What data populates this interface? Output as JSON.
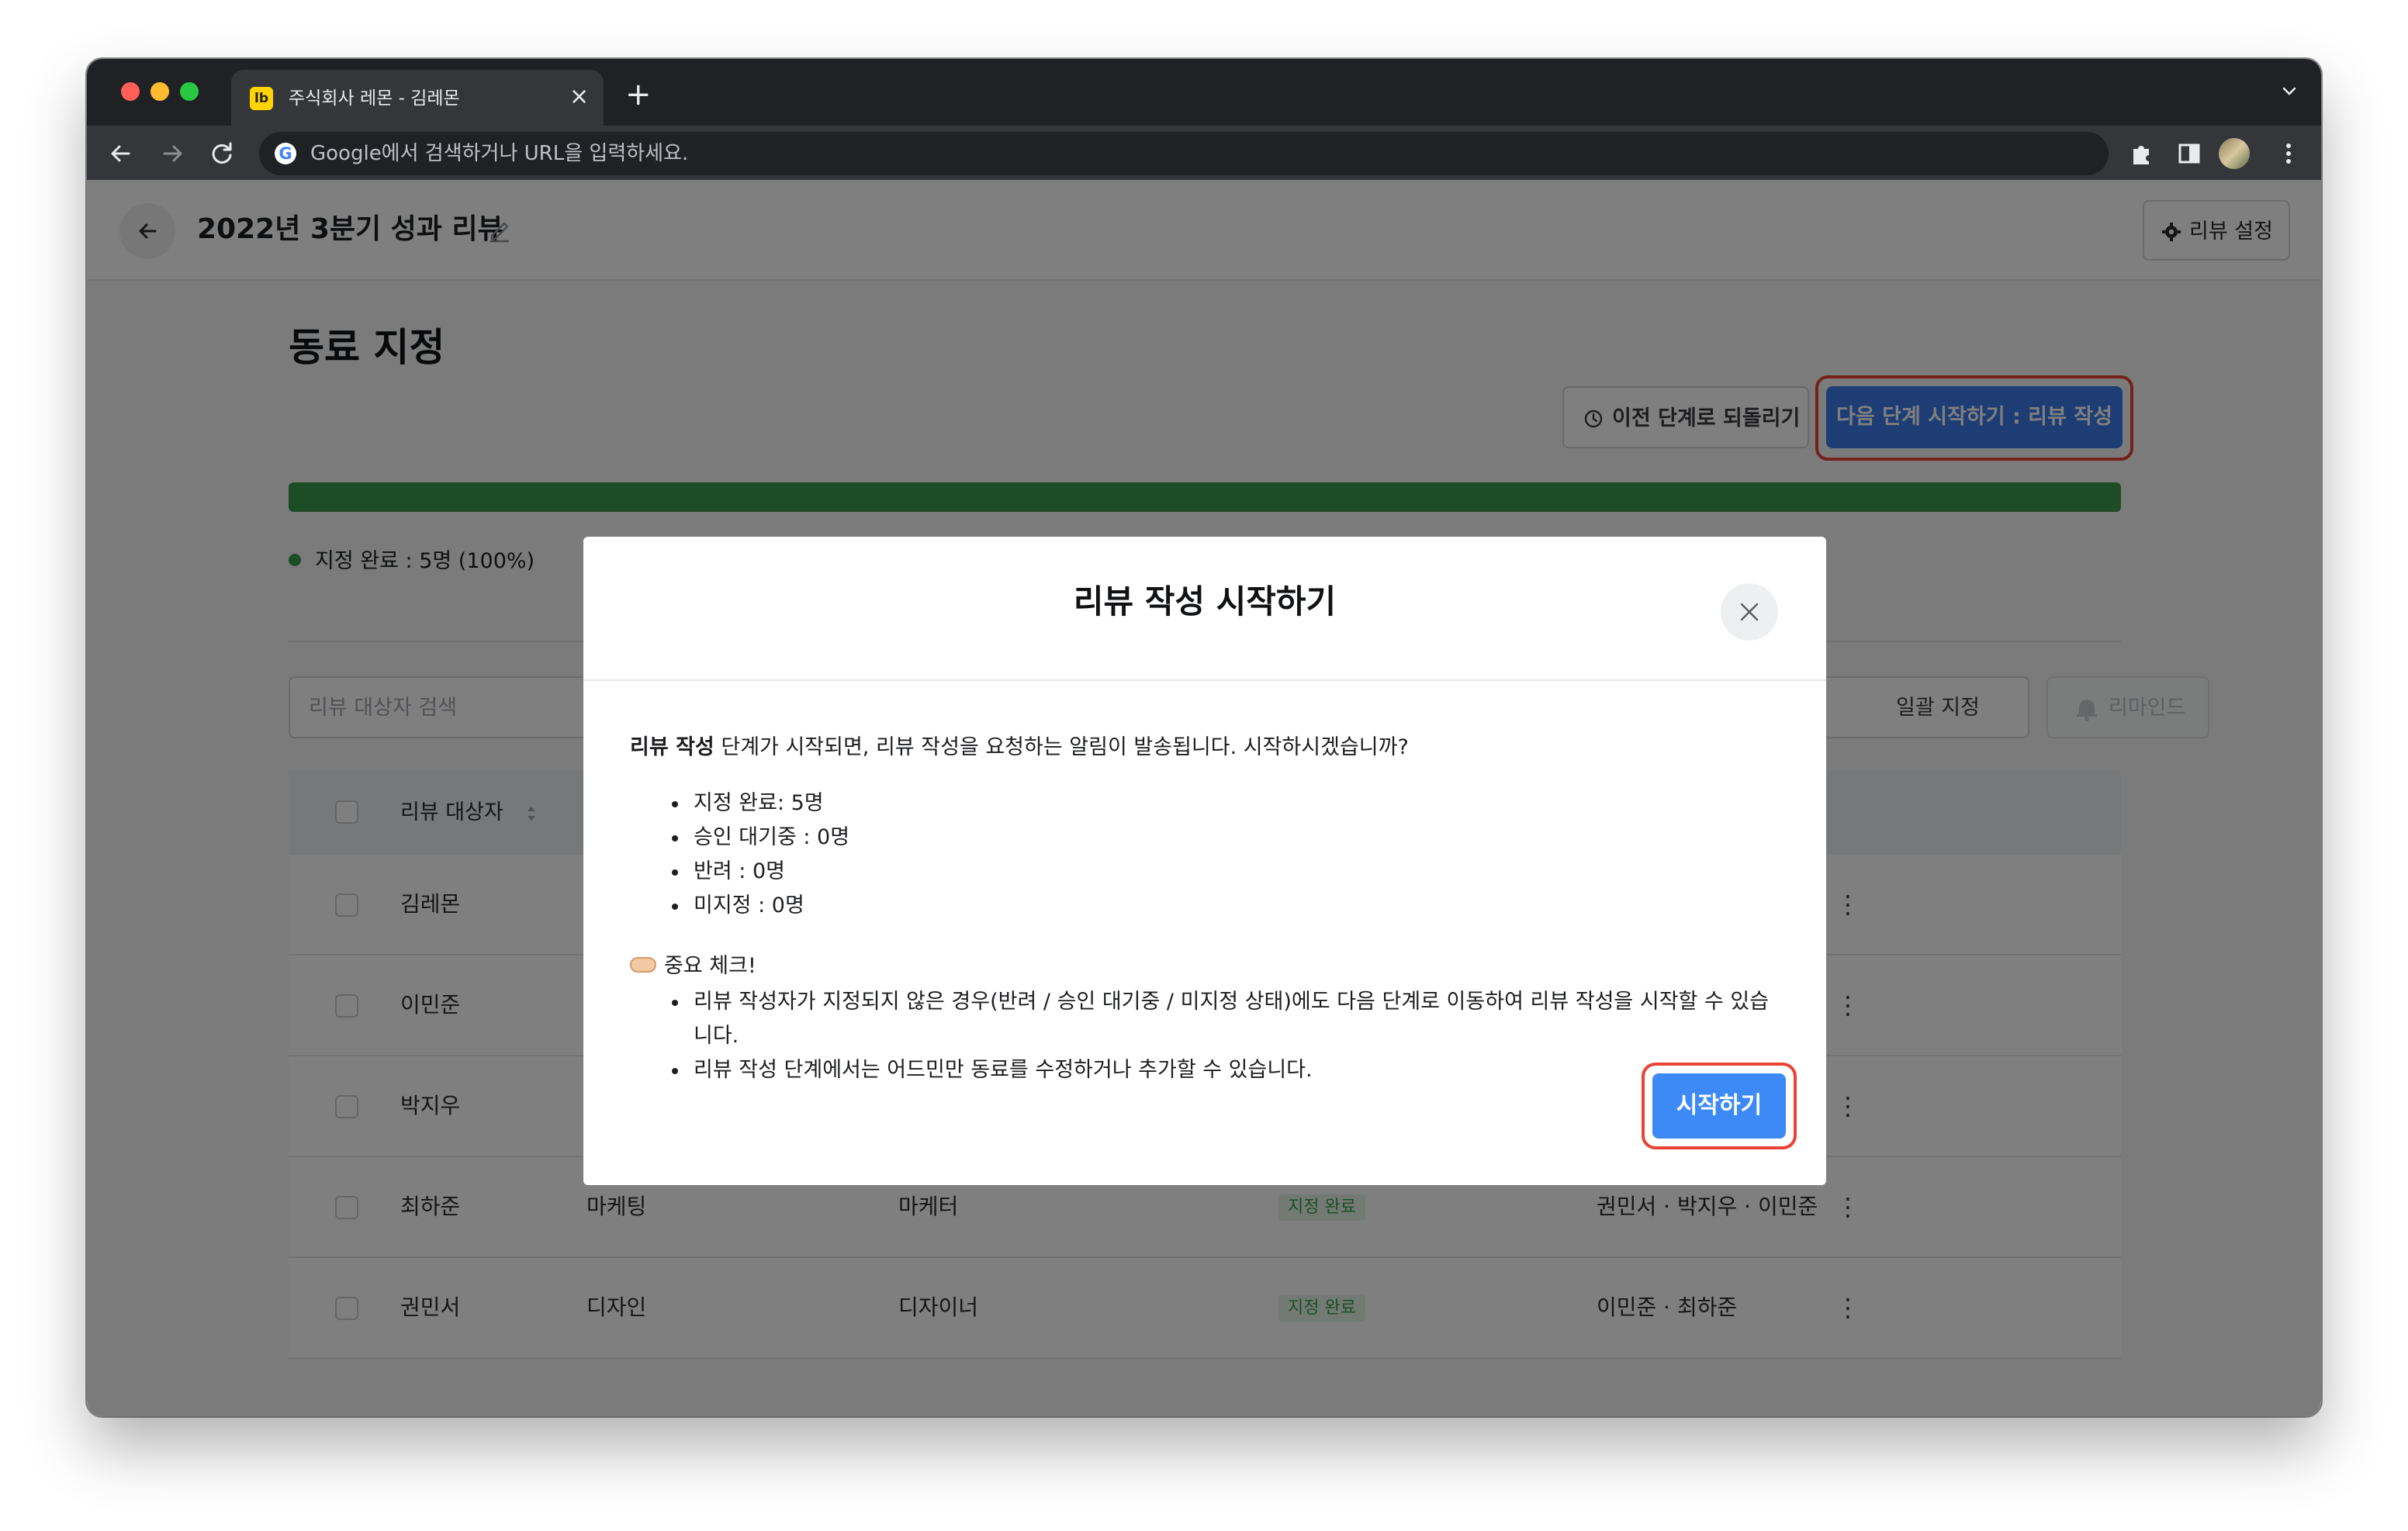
{
  "browser": {
    "tab_title": "주식회사 레몬 - 김레몬",
    "tab_favicon_text": "lb",
    "omnibox_placeholder": "Google에서 검색하거나 URL을 입력하세요."
  },
  "header": {
    "title": "2022년 3분기 성과 리뷰",
    "settings_label": "리뷰 설정"
  },
  "main": {
    "section_title": "동료 지정",
    "revert_label": "이전 단계로 되돌리기",
    "next_label": "다음 단계 시작하기 : 리뷰 작성",
    "progress_fraction": 1.0,
    "legend_label": "지정 완료 : 5명 (100%)",
    "search_placeholder": "리뷰 대상자 검색",
    "bulk_label": "일괄 지정",
    "remind_label": "리마인드",
    "table": {
      "header_target": "리뷰 대상자",
      "rows": [
        {
          "name": "김레몬"
        },
        {
          "name": "이민준"
        },
        {
          "name": "박지우"
        },
        {
          "name": "최하준",
          "dept": "마케팅",
          "role": "마케터",
          "status": "지정 완료",
          "peers": "권민서 · 박지우 · 이민준"
        },
        {
          "name": "권민서",
          "dept": "디자인",
          "role": "디자이너",
          "status": "지정 완료",
          "peers": "이민준 · 최하준"
        }
      ]
    }
  },
  "modal": {
    "title": "리뷰 작성 시작하기",
    "intro_bold": "리뷰 작성",
    "intro_rest": " 단계가 시작되면, 리뷰 작성을 요청하는 알림이 발송됩니다. 시작하시겠습니까?",
    "stats": [
      "지정 완료: 5명",
      "승인 대기중 : 0명",
      "반려 : 0명",
      "미지정 : 0명"
    ],
    "check_title": "중요 체크!",
    "notes": [
      "리뷰 작성자가 지정되지 않은 경우(반려 / 승인 대기중 / 미지정 상태)에도 다음 단계로 이동하여 리뷰 작성을 시작할 수 있습니다.",
      "리뷰 작성 단계에서는 어드민만 동료를 수정하거나 추가할 수 있습니다."
    ],
    "start_label": "시작하기"
  },
  "colors": {
    "accent": "#3d8af7",
    "progress": "#3b9b4a",
    "highlight": "#ea4335"
  }
}
